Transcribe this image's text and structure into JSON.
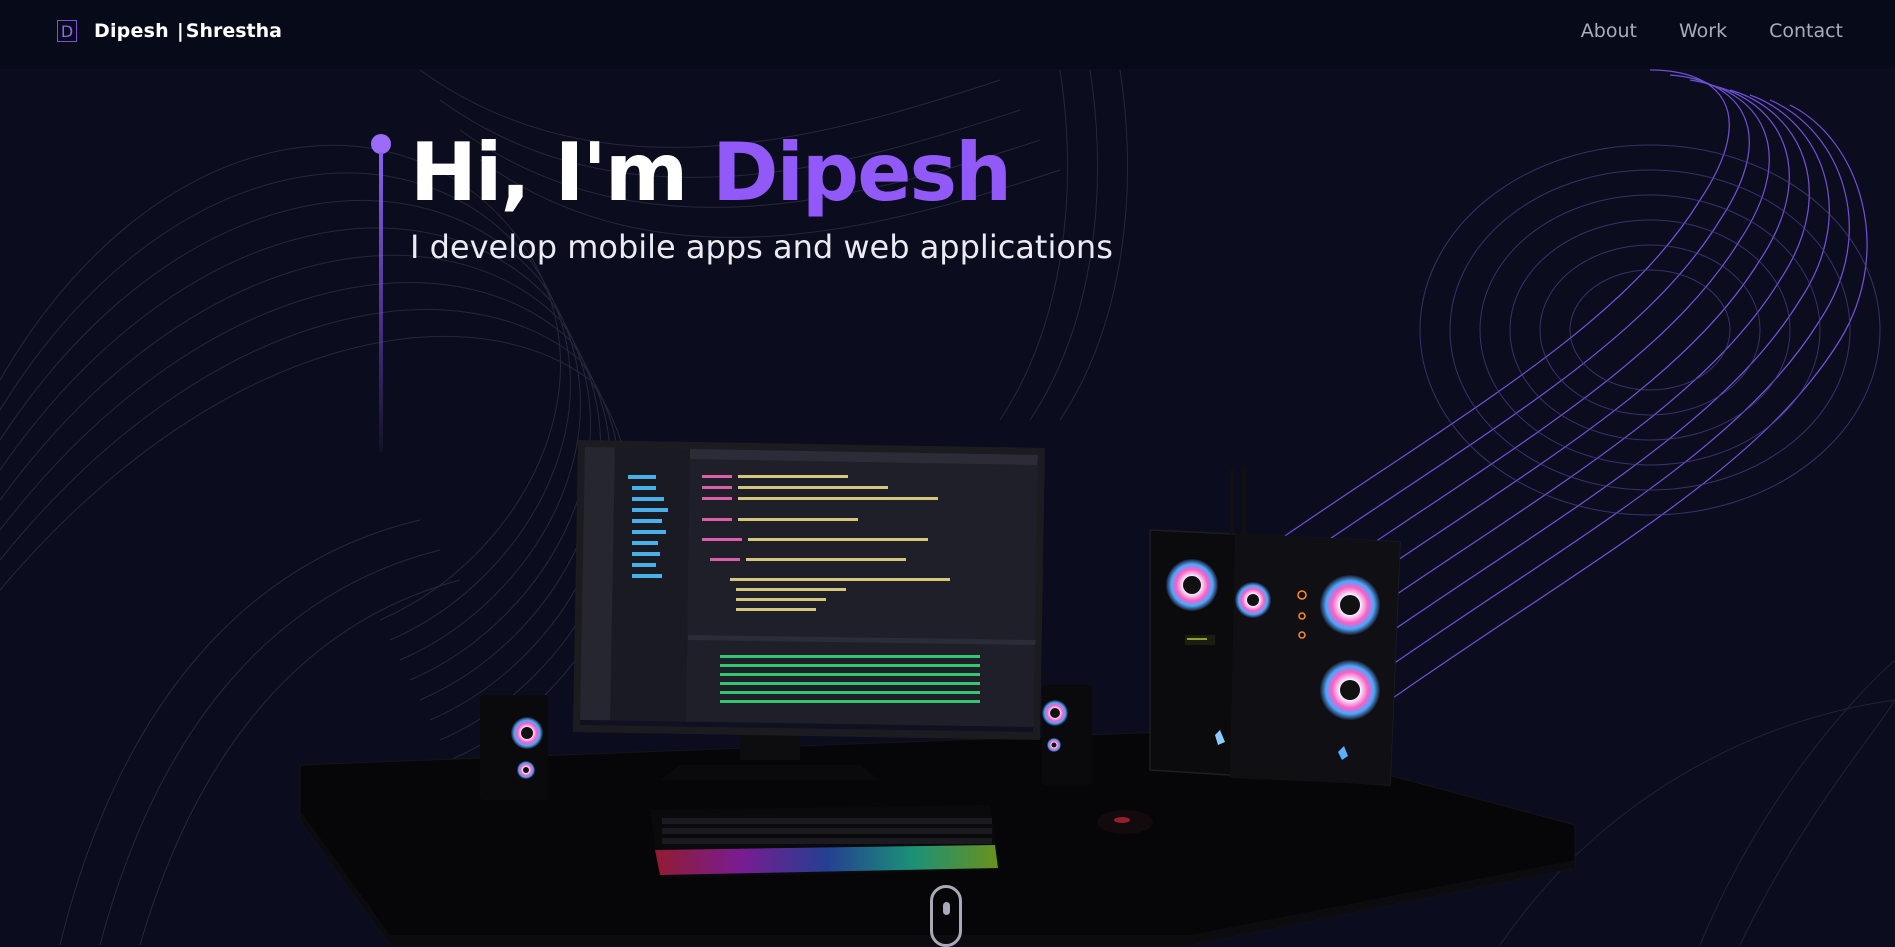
{
  "brand": {
    "logo_letter": "D",
    "first_name": "Dipesh",
    "separator": "|",
    "last_name": "Shrestha"
  },
  "nav": {
    "items": [
      {
        "label": "About"
      },
      {
        "label": "Work"
      },
      {
        "label": "Contact"
      }
    ]
  },
  "hero": {
    "greeting": "Hi, I'm",
    "name": "Dipesh",
    "subtitle": "I develop mobile apps and web applications"
  },
  "colors": {
    "accent": "#9159f7",
    "background": "#0b0d1e",
    "navbar": "#070a18",
    "nav_text": "#a9acbd"
  },
  "icons": {
    "logo": "d-logo-icon",
    "scroll": "mouse-scroll-icon"
  }
}
